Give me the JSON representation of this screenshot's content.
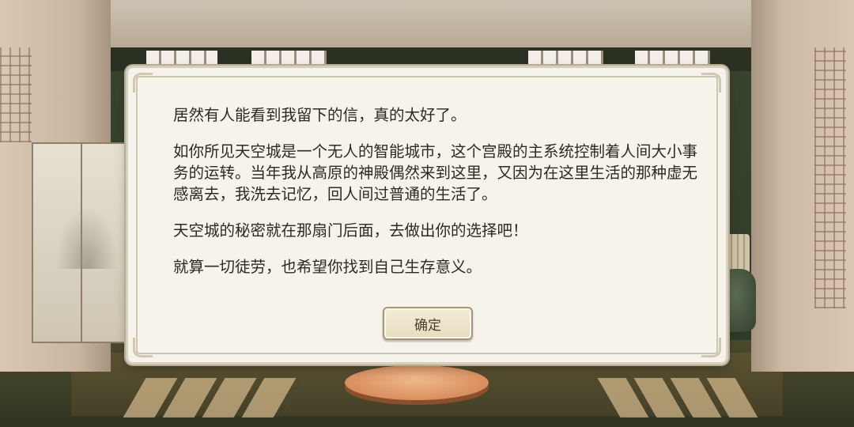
{
  "dialog": {
    "paragraphs": [
      "居然有人能看到我留下的信，真的太好了。",
      "如你所见天空城是一个无人的智能城市，这个宫殿的主系统控制着人间大小事务的运转。当年我从高原的神殿偶然来到这里，又因为在这里生活的那种虚无感离去，我洗去记忆，回人间过普通的生活了。",
      "天空城的秘密就在那扇门后面，去做出你的选择吧！",
      "就算一切徒劳，也希望你找到自己生存意义。"
    ],
    "confirm_label": "确定"
  },
  "colors": {
    "dialog_bg": "#f6f3ea",
    "dialog_border": "#b7ab93",
    "text": "#2c2a26",
    "cushion": "#d98f5e"
  }
}
